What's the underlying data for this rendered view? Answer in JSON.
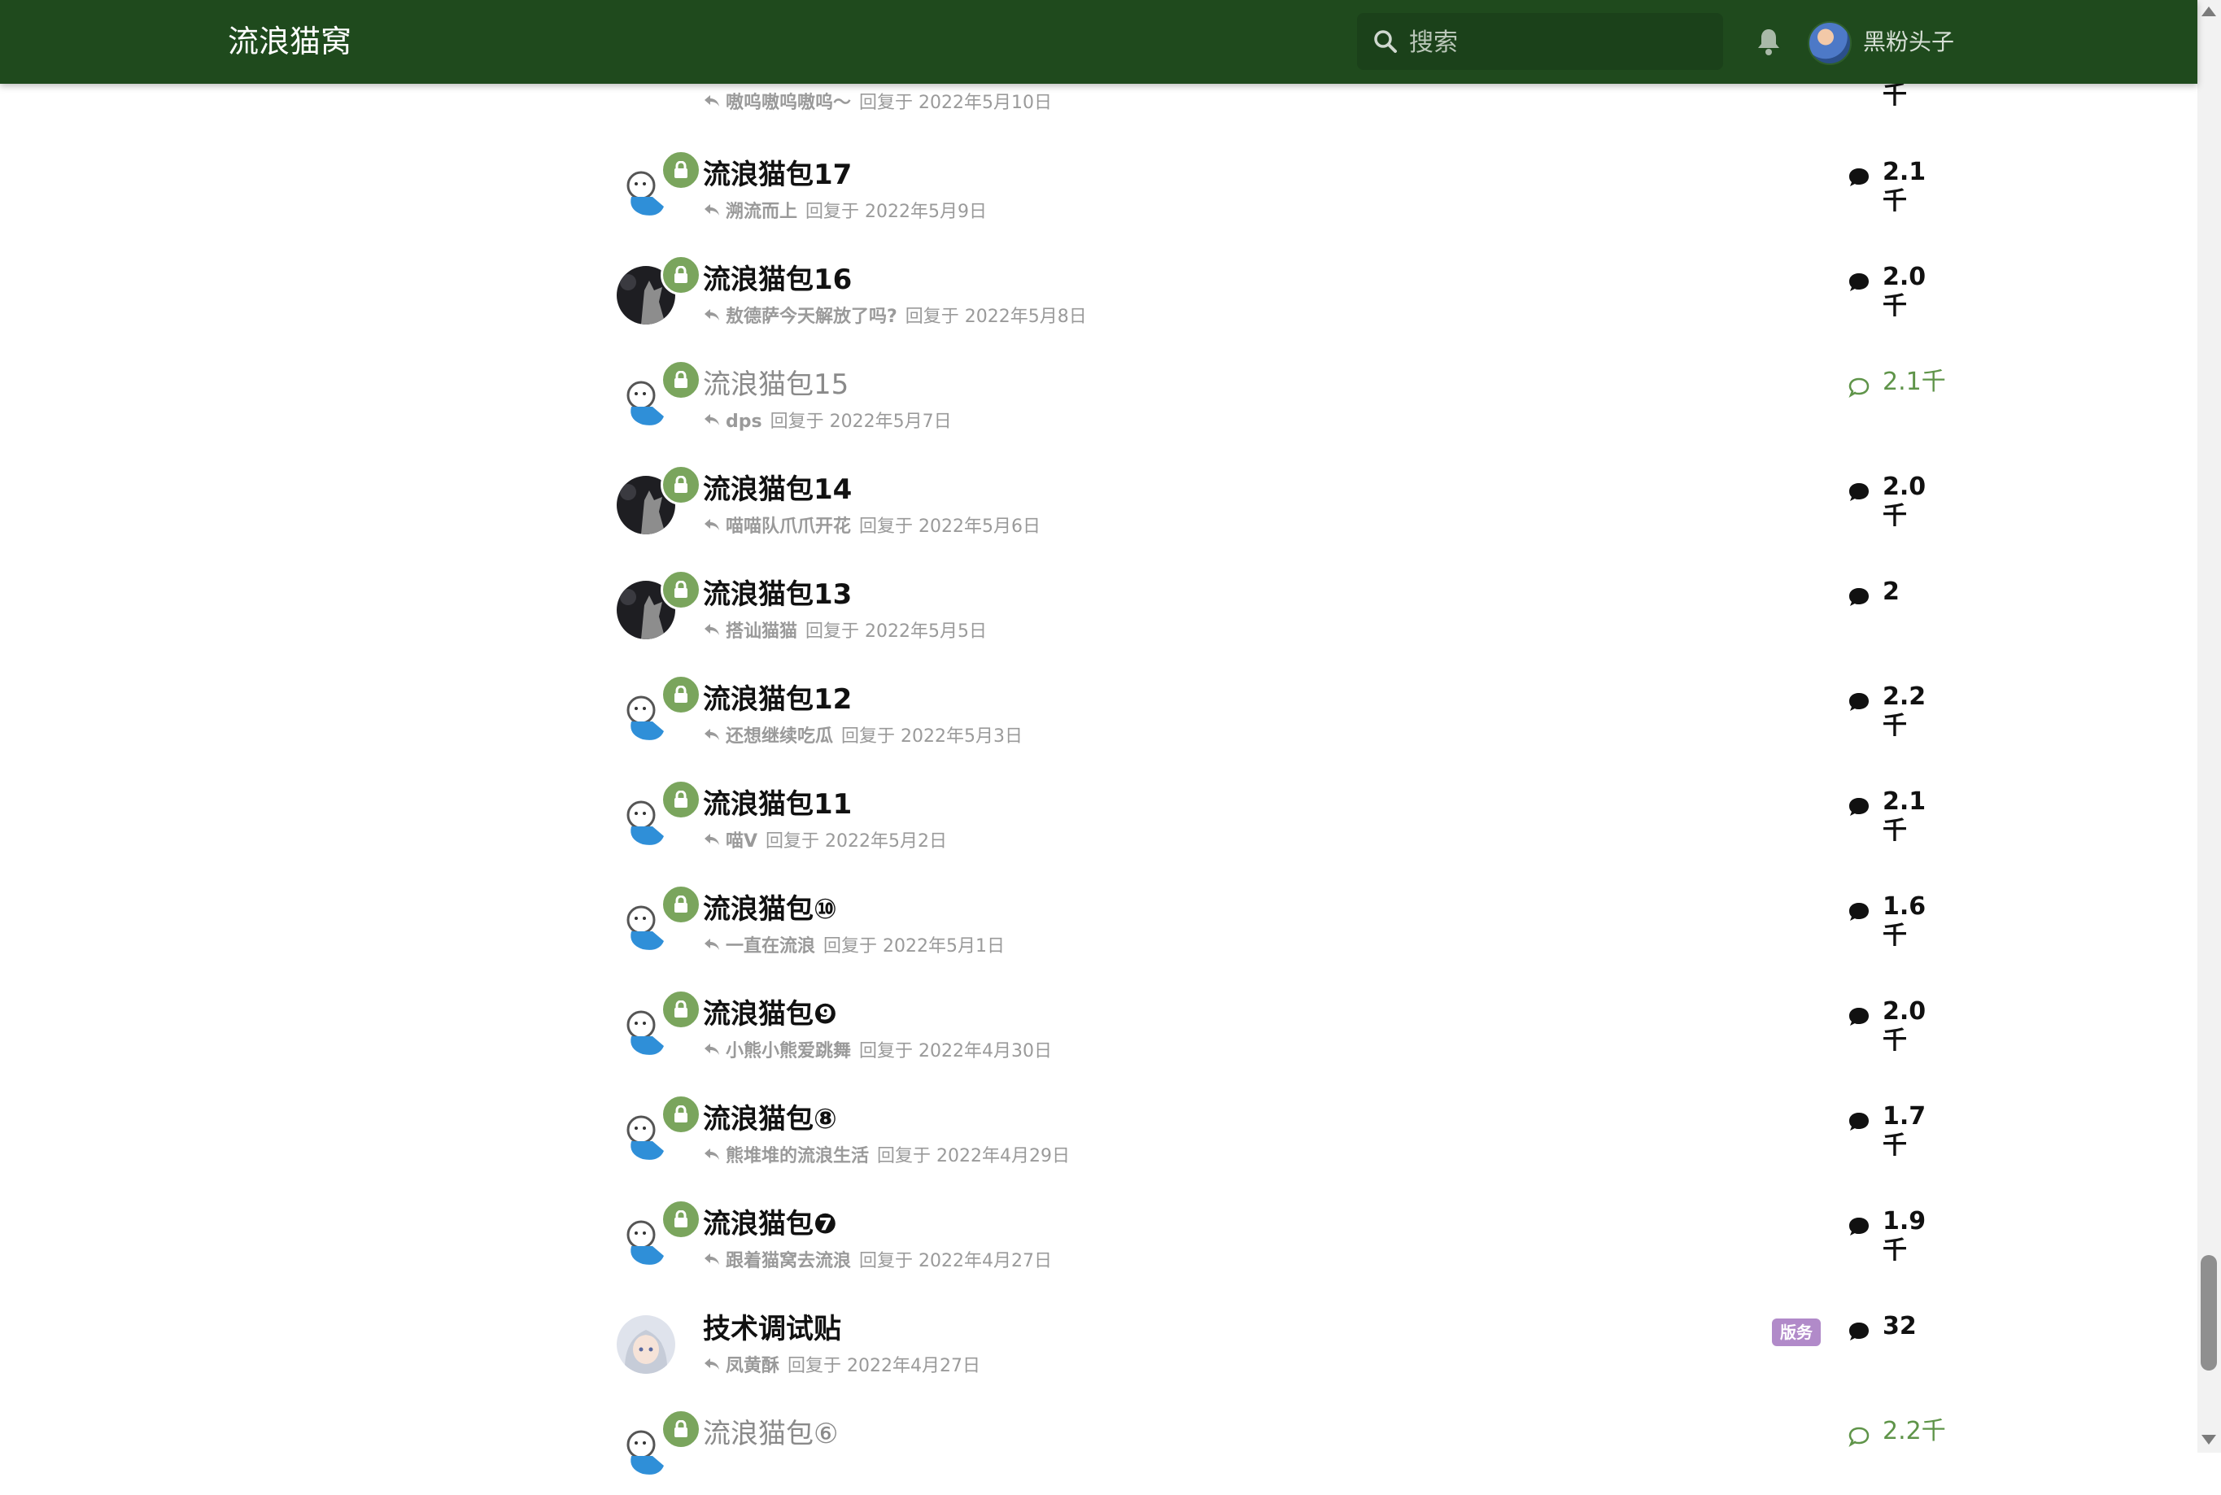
{
  "header": {
    "site_title": "流浪猫窝",
    "search_placeholder": "搜索",
    "user_name": "黑粉头子",
    "colors": {
      "bar": "#1f4a1d",
      "lock_badge": "#7aa55d",
      "read_count": "#5f9449",
      "tag": "#b18ac9"
    }
  },
  "topics": [
    {
      "title": "",
      "reply_user": "嗷呜嗷呜嗷呜～",
      "reply_text": "回复于 2022年5月10日",
      "count": "千",
      "read": false,
      "avatar": "cartoon",
      "locked": true,
      "tag": ""
    },
    {
      "title": "流浪猫包17",
      "reply_user": "溯流而上",
      "reply_text": "回复于 2022年5月9日",
      "count": "2.1千",
      "read": false,
      "avatar": "cartoon",
      "locked": true,
      "tag": ""
    },
    {
      "title": "流浪猫包16",
      "reply_user": "敖德萨今天解放了吗?",
      "reply_text": "回复于 2022年5月8日",
      "count": "2.0千",
      "read": false,
      "avatar": "cat",
      "locked": true,
      "tag": ""
    },
    {
      "title": "流浪猫包15",
      "reply_user": "dps",
      "reply_text": "回复于 2022年5月7日",
      "count": "2.1千",
      "read": true,
      "avatar": "cartoon",
      "locked": true,
      "tag": ""
    },
    {
      "title": "流浪猫包14",
      "reply_user": "喵喵队爪爪开花",
      "reply_text": "回复于 2022年5月6日",
      "count": "2.0千",
      "read": false,
      "avatar": "cat",
      "locked": true,
      "tag": ""
    },
    {
      "title": "流浪猫包13",
      "reply_user": "搭讪猫猫",
      "reply_text": "回复于 2022年5月5日",
      "count": "2",
      "read": false,
      "avatar": "cat",
      "locked": true,
      "tag": ""
    },
    {
      "title": "流浪猫包12",
      "reply_user": "还想继续吃瓜",
      "reply_text": "回复于 2022年5月3日",
      "count": "2.2千",
      "read": false,
      "avatar": "cartoon",
      "locked": true,
      "tag": ""
    },
    {
      "title": "流浪猫包11",
      "reply_user": "喵V",
      "reply_text": "回复于 2022年5月2日",
      "count": "2.1千",
      "read": false,
      "avatar": "cartoon",
      "locked": true,
      "tag": ""
    },
    {
      "title": "流浪猫包⑩",
      "reply_user": "一直在流浪",
      "reply_text": "回复于 2022年5月1日",
      "count": "1.6千",
      "read": false,
      "avatar": "cartoon",
      "locked": true,
      "tag": ""
    },
    {
      "title": "流浪猫包❾",
      "reply_user": "小熊小熊爱跳舞",
      "reply_text": "回复于 2022年4月30日",
      "count": "2.0千",
      "read": false,
      "avatar": "cartoon",
      "locked": true,
      "tag": ""
    },
    {
      "title": "流浪猫包⑧",
      "reply_user": "熊堆堆的流浪生活",
      "reply_text": "回复于 2022年4月29日",
      "count": "1.7千",
      "read": false,
      "avatar": "cartoon",
      "locked": true,
      "tag": ""
    },
    {
      "title": "流浪猫包❼",
      "reply_user": "跟着猫窝去流浪",
      "reply_text": "回复于 2022年4月27日",
      "count": "1.9千",
      "read": false,
      "avatar": "cartoon",
      "locked": true,
      "tag": ""
    },
    {
      "title": "技术调试贴",
      "reply_user": "凤黄酥",
      "reply_text": "回复于 2022年4月27日",
      "count": "32",
      "read": false,
      "avatar": "anime",
      "locked": false,
      "tag": "版务"
    },
    {
      "title": "流浪猫包⑥",
      "reply_user": "",
      "reply_text": "",
      "count": "2.2千",
      "read": true,
      "avatar": "cartoon",
      "locked": true,
      "tag": ""
    }
  ]
}
